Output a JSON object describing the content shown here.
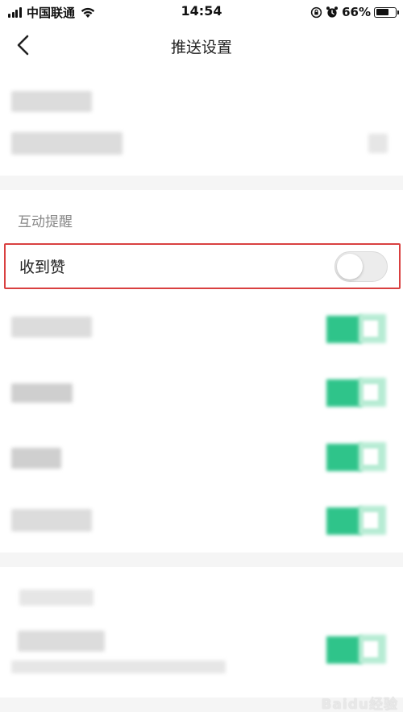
{
  "status_bar": {
    "carrier": "中国联通",
    "time": "14:54",
    "battery_percent": "66%",
    "battery_level": 0.66,
    "icons": [
      "signal-icon",
      "wifi-icon",
      "rotation-lock-icon",
      "alarm-icon",
      "battery-icon"
    ]
  },
  "nav": {
    "title": "推送设置",
    "back_icon": "chevron-left-icon"
  },
  "section": {
    "title": "互动提醒"
  },
  "highlighted_row": {
    "label": "收到赞",
    "toggle_on": false
  },
  "blurred_toggles_on": [
    true,
    true,
    true,
    true,
    true
  ],
  "colors": {
    "accent_green": "#2fc48a",
    "highlight_border": "#d94040",
    "section_title": "#8a8a8a"
  },
  "watermark": "Baidu经验"
}
